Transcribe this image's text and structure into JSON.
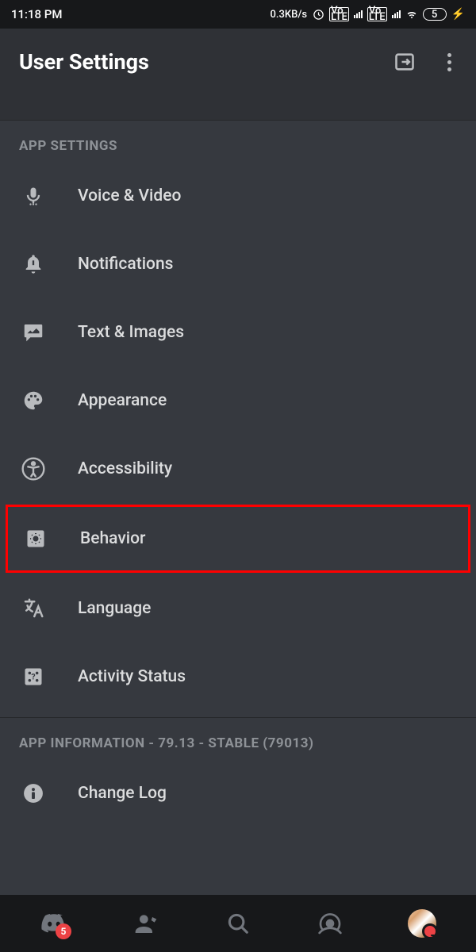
{
  "status_bar": {
    "time": "11:18 PM",
    "data_rate": "0.3KB/s",
    "battery_level": "5"
  },
  "header": {
    "title": "User Settings"
  },
  "sections": {
    "app_settings": {
      "title": "APP SETTINGS",
      "items": [
        {
          "icon": "mic",
          "label": "Voice & Video"
        },
        {
          "icon": "bell",
          "label": "Notifications"
        },
        {
          "icon": "image-chat",
          "label": "Text & Images"
        },
        {
          "icon": "palette",
          "label": "Appearance"
        },
        {
          "icon": "accessibility",
          "label": "Accessibility"
        },
        {
          "icon": "gear-box",
          "label": "Behavior",
          "highlighted": true
        },
        {
          "icon": "language",
          "label": "Language"
        },
        {
          "icon": "dice",
          "label": "Activity Status"
        }
      ]
    },
    "app_info": {
      "title": "APP INFORMATION - 79.13 - STABLE (79013)",
      "items": [
        {
          "icon": "info",
          "label": "Change Log"
        }
      ]
    }
  },
  "bottom_nav": {
    "badge_count": "5"
  }
}
